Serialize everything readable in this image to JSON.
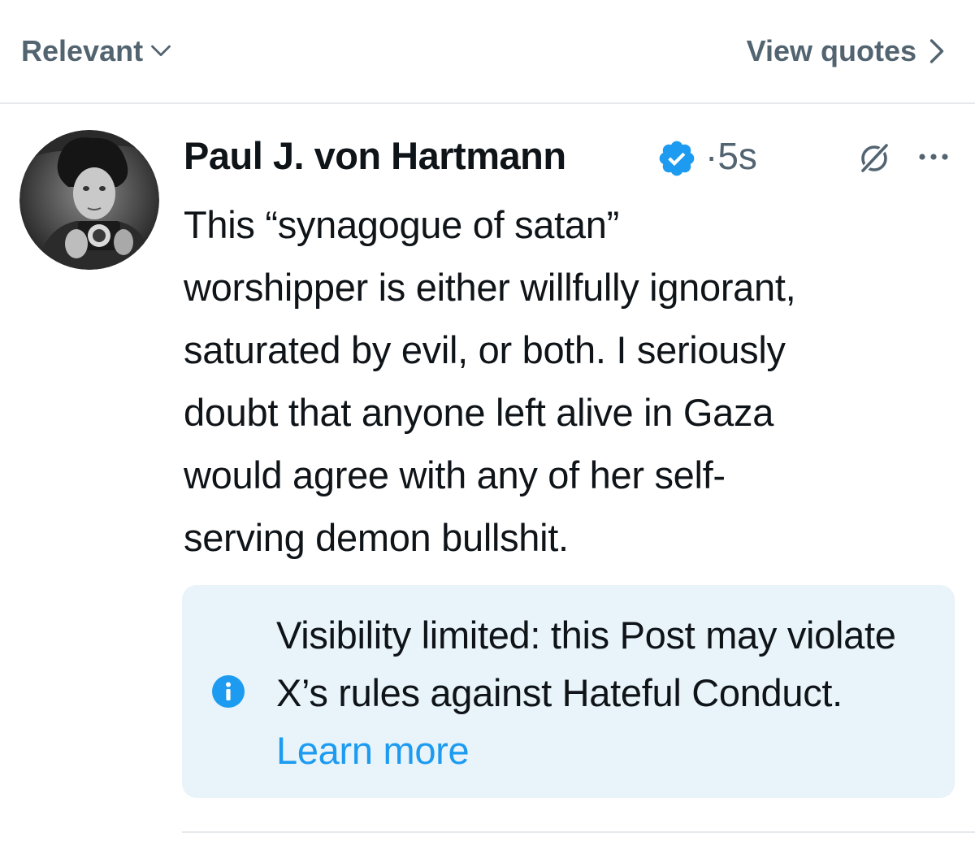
{
  "topbar": {
    "sort_label": "Relevant",
    "sort_icon": "chevron-down-icon",
    "view_quotes_label": "View quotes",
    "view_quotes_icon": "chevron-right-icon"
  },
  "post": {
    "author_name": "Paul J. von Hartmann",
    "verified": true,
    "separator": "·",
    "timestamp": "5s",
    "body": "This “synagogue of satan”\nworshipper is either willfully ignorant,\nsaturated by evil, or both. I seriously\ndoubt that anyone left alive in Gaza\nwould agree with any of her self-\nserving demon bullshit.",
    "notice": {
      "text": "Visibility limited: this Post may violate X’s rules against Hateful Conduct.",
      "link_label": "Learn more"
    }
  },
  "colors": {
    "accent": "#1d9bf0",
    "secondary_text": "#536471",
    "notice_background": "#e8f3fa",
    "divider": "#e6e9ec"
  }
}
